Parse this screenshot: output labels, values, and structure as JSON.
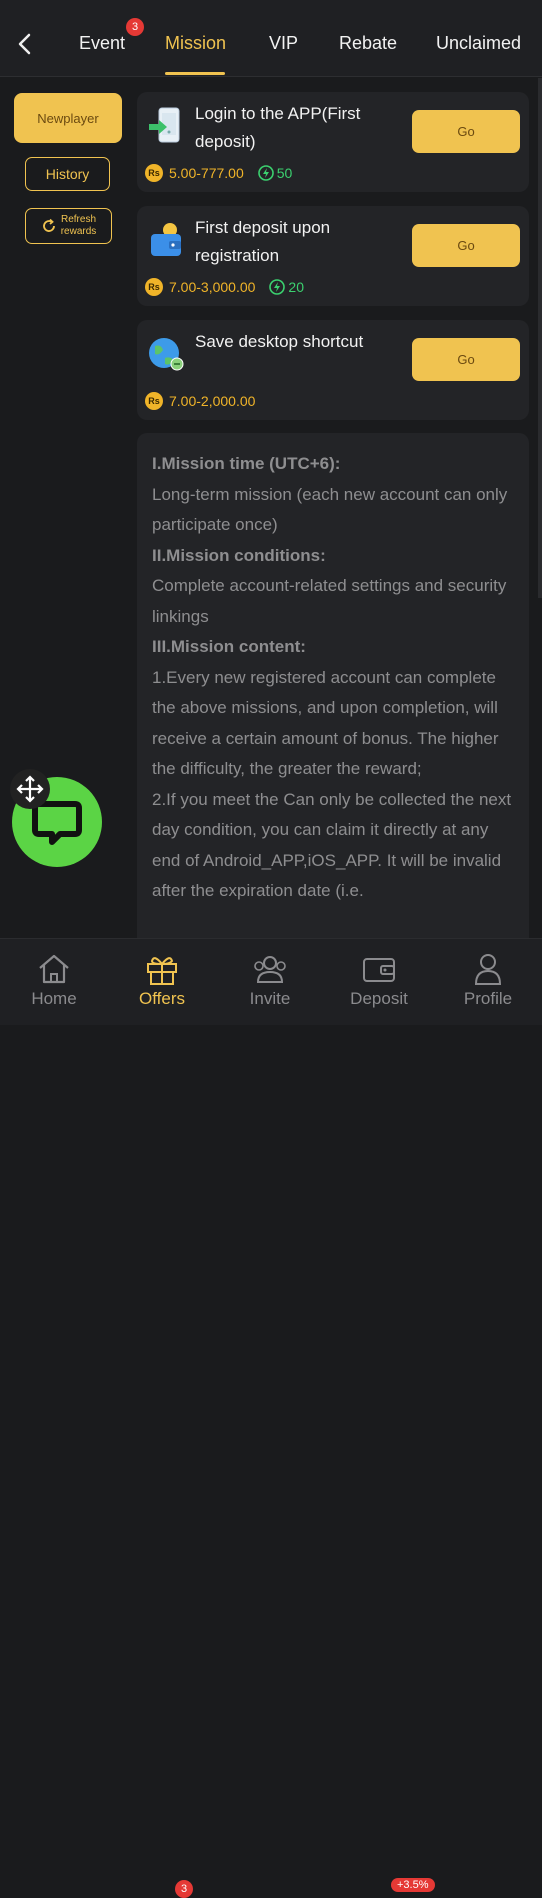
{
  "tabs": [
    {
      "label": "Event",
      "badge": "3"
    },
    {
      "label": "Mission"
    },
    {
      "label": "VIP"
    },
    {
      "label": "Rebate"
    },
    {
      "label": "Unclaimed"
    }
  ],
  "sidebar": {
    "newplayer": "Newplayer",
    "history": "History",
    "refresh_line1": "Refresh",
    "refresh_line2": "rewards"
  },
  "missions": [
    {
      "title": "Login to the APP(First deposit)",
      "currency": "Rs",
      "amount": "5.00-777.00",
      "points": "50",
      "go": "Go"
    },
    {
      "title": "First deposit upon registration",
      "currency": "Rs",
      "amount": "7.00-3,000.00",
      "points": "20",
      "go": "Go"
    },
    {
      "title": "Save desktop shortcut",
      "currency": "Rs",
      "amount": "7.00-2,000.00",
      "go": "Go"
    }
  ],
  "description": {
    "h1": "I.Mission time (UTC+6):",
    "p1": "Long-term mission (each new account can only participate once)",
    "h2": "II.Mission conditions:",
    "p2": "Complete account-related settings and security linkings",
    "h3": "III.Mission content:",
    "p3": "1.Every new registered account can complete the above missions, and upon completion, will receive a certain amount of bonus. The higher the difficulty, the greater the reward;",
    "p4": "2.If you meet the Can only be collected the next day condition, you can claim it directly at any end of Android_APP,iOS_APP. It will be invalid after the expiration date (i.e."
  },
  "bottom_nav": [
    {
      "label": "Home",
      "icon": "home-icon"
    },
    {
      "label": "Offers",
      "icon": "gift-icon",
      "badge": "3"
    },
    {
      "label": "Invite",
      "icon": "users-icon"
    },
    {
      "label": "Deposit",
      "icon": "wallet-icon",
      "badge": "+3.5%"
    },
    {
      "label": "Profile",
      "icon": "user-icon"
    }
  ],
  "colors": {
    "accent": "#f0c350",
    "background": "#1a1b1d",
    "card": "#232427",
    "points": "#3bd16f",
    "badge": "#e53935",
    "chat": "#5bd445"
  }
}
